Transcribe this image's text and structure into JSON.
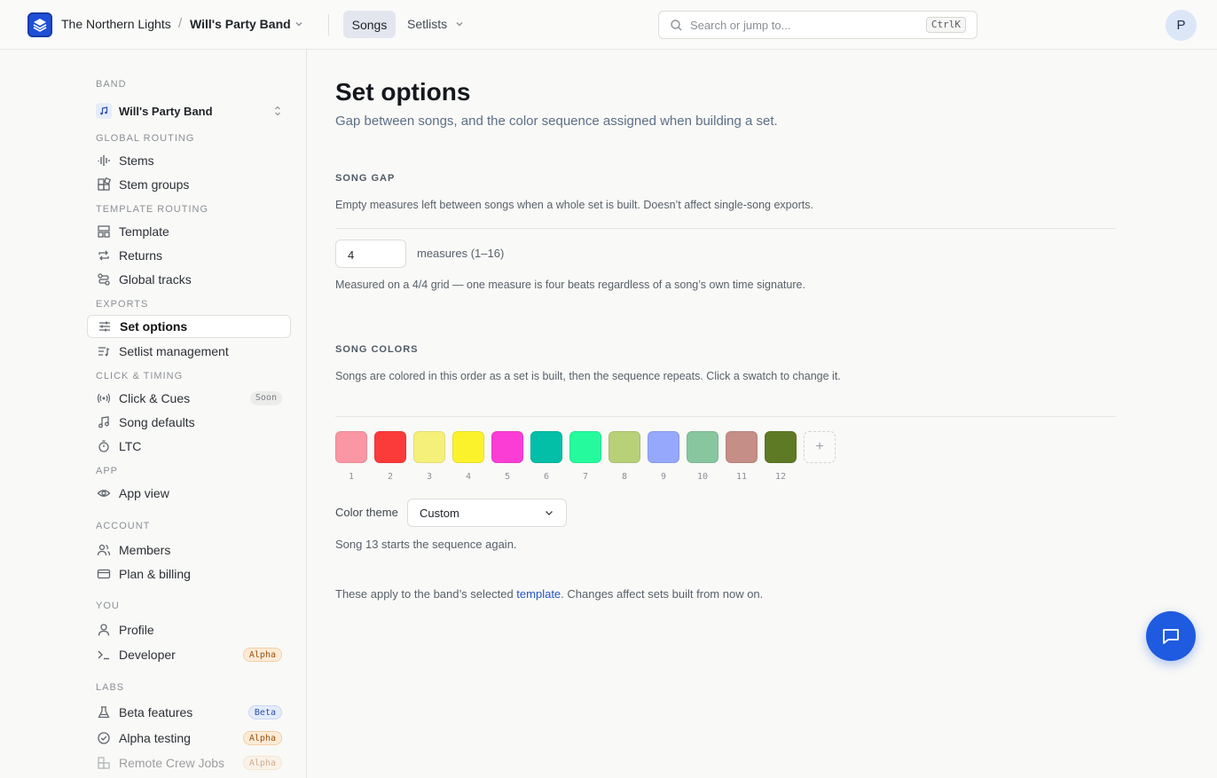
{
  "topbar": {
    "org_name": "The Northern Lights",
    "separator": "/",
    "band_name": "Will's Party Band",
    "nav": {
      "songs": "Songs",
      "setlists": "Setlists"
    },
    "search": {
      "placeholder": "Search or jump to...",
      "shortcut": "CtrlK"
    },
    "avatar_initial": "P"
  },
  "sidebar": {
    "band_section": "BAND",
    "band_select": "Will's Party Band",
    "sections": {
      "global_routing": "GLOBAL ROUTING",
      "template_routing": "TEMPLATE ROUTING",
      "exports": "EXPORTS",
      "click_timing": "CLICK & TIMING",
      "app": "APP",
      "account": "ACCOUNT",
      "you": "YOU",
      "labs": "LABS"
    },
    "items": {
      "stems": "Stems",
      "stem_groups": "Stem groups",
      "template": "Template",
      "returns": "Returns",
      "global_tracks": "Global tracks",
      "set_options": "Set options",
      "setlist_management": "Setlist management",
      "click_cues": "Click & Cues",
      "song_defaults": "Song defaults",
      "ltc": "LTC",
      "app_view": "App view",
      "members": "Members",
      "plan_billing": "Plan & billing",
      "profile": "Profile",
      "developer": "Developer",
      "beta_features": "Beta features",
      "alpha_testing": "Alpha testing",
      "remote_crew_jobs": "Remote Crew Jobs"
    },
    "badges": {
      "soon": "Soon",
      "alpha": "Alpha",
      "beta": "Beta"
    }
  },
  "main": {
    "title": "Set options",
    "subtitle": "Gap between songs, and the color sequence assigned when building a set.",
    "song_gap": {
      "heading": "SONG GAP",
      "description": "Empty measures left between songs when a whole set is built. Doesn’t affect single-song exports.",
      "value": "4",
      "unit": "measures (1–16)",
      "help": "Measured on a 4/4 grid — one measure is four beats regardless of a song’s own time signature."
    },
    "song_colors": {
      "heading": "SONG COLORS",
      "description": "Songs are colored in this order as a set is built, then the sequence repeats. Click a swatch to change it.",
      "swatches": [
        {
          "num": "1",
          "color": "#fb96a4"
        },
        {
          "num": "2",
          "color": "#fb3a3a"
        },
        {
          "num": "3",
          "color": "#f5f07a"
        },
        {
          "num": "4",
          "color": "#fcf22c"
        },
        {
          "num": "5",
          "color": "#fb3dd6"
        },
        {
          "num": "6",
          "color": "#03bfa8"
        },
        {
          "num": "7",
          "color": "#25fb9d"
        },
        {
          "num": "8",
          "color": "#b8d078"
        },
        {
          "num": "9",
          "color": "#95a8fb"
        },
        {
          "num": "10",
          "color": "#87c69e"
        },
        {
          "num": "11",
          "color": "#c58e87"
        },
        {
          "num": "12",
          "color": "#5e7a24"
        }
      ],
      "add_label": "+",
      "theme_label": "Color theme",
      "theme_value": "Custom",
      "repeat_note": "Song 13 starts the sequence again."
    },
    "footer_note": {
      "before": "These apply to the band’s selected ",
      "link": "template",
      "after": ". Changes affect sets built from now on."
    }
  }
}
